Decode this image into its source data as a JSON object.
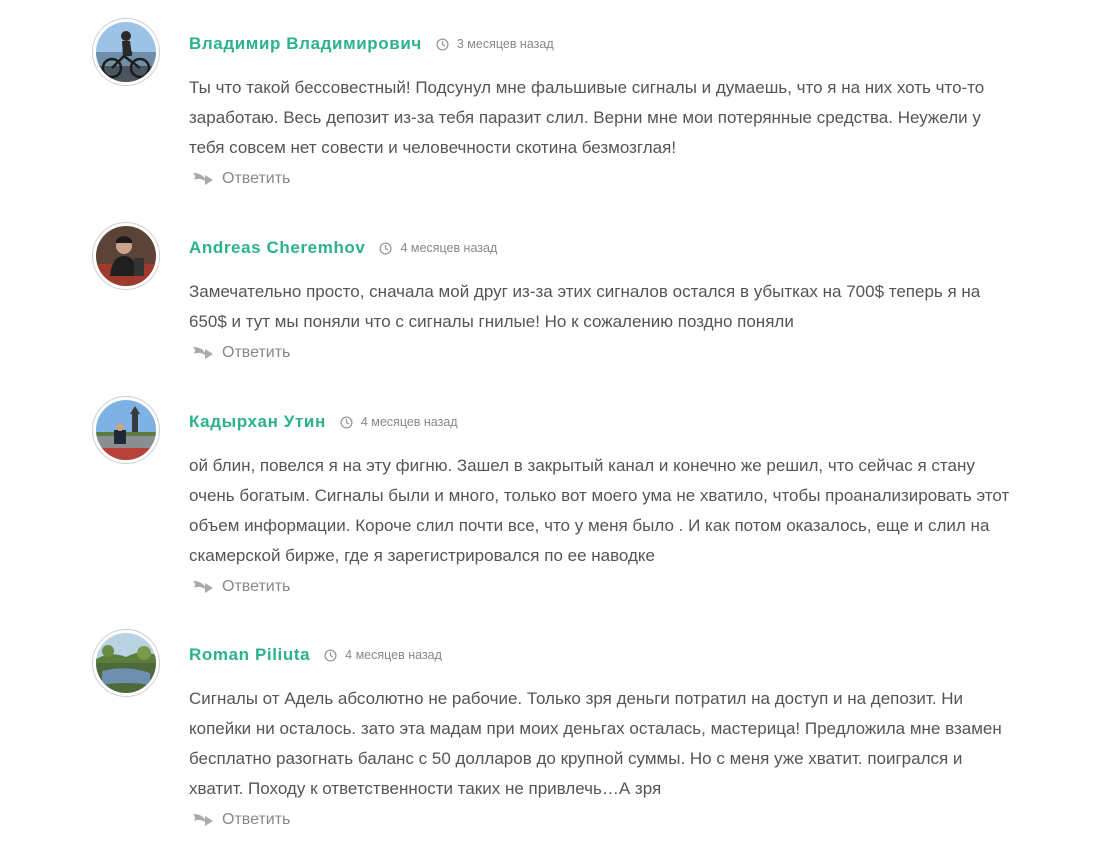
{
  "comments": [
    {
      "author": "Владимир Владимирович",
      "date": "3 месяцев назад",
      "text": "Ты что такой бессовестный! Подсунул мне фальшивые сигналы и думаешь, что я на них хоть что-то заработаю. Весь депозит из-за тебя паразит слил. Верни мне мои потерянные средства. Неужели у тебя совсем нет совести и человечности скотина безмозглая!",
      "reply_label": "Ответить"
    },
    {
      "author": "Andreas Cheremhov",
      "date": "4 месяцев назад",
      "text": "Замечательно просто, сначала мой друг из-за этих сигналов остался в убытках на 700$ теперь я на 650$ и тут мы поняли что с сигналы гнилые! Но к сожалению поздно поняли",
      "reply_label": "Ответить"
    },
    {
      "author": "Кадырхан Утин",
      "date": "4 месяцев назад",
      "text": "ой блин, повелся я на эту фигню. Зашел в закрытый канал и конечно же решил, что сейчас я стану очень богатым. Сигналы были и много, только вот моего ума не хватило, чтобы проанализировать этот объем информации. Короче слил почти все, что у меня было . И как потом оказалось, еще и слил на скамерской бирже, где я зарегистрировался по ее наводке",
      "reply_label": "Ответить"
    },
    {
      "author": "Roman Piliuta",
      "date": "4 месяцев назад",
      "text": "Сигналы от Адель абсолютно не рабочие. Только зря деньги потратил на доступ и на депозит. Ни копейки ни осталось. зато эта мадам при моих деньгах осталась, мастерица! Предложила мне взамен бесплатно разогнать баланс с 50 долларов до крупной суммы. Но с меня уже хватит. поигрался и хватит. Походу к ответственности таких не привлечь…А зря",
      "reply_label": "Ответить"
    }
  ],
  "colors": {
    "author": "#2bb28c",
    "text": "#555555",
    "meta": "#888888",
    "icon": "#aaaaaa"
  },
  "icons": {
    "date": "clock-icon",
    "reply": "reply-arrow-icon"
  }
}
